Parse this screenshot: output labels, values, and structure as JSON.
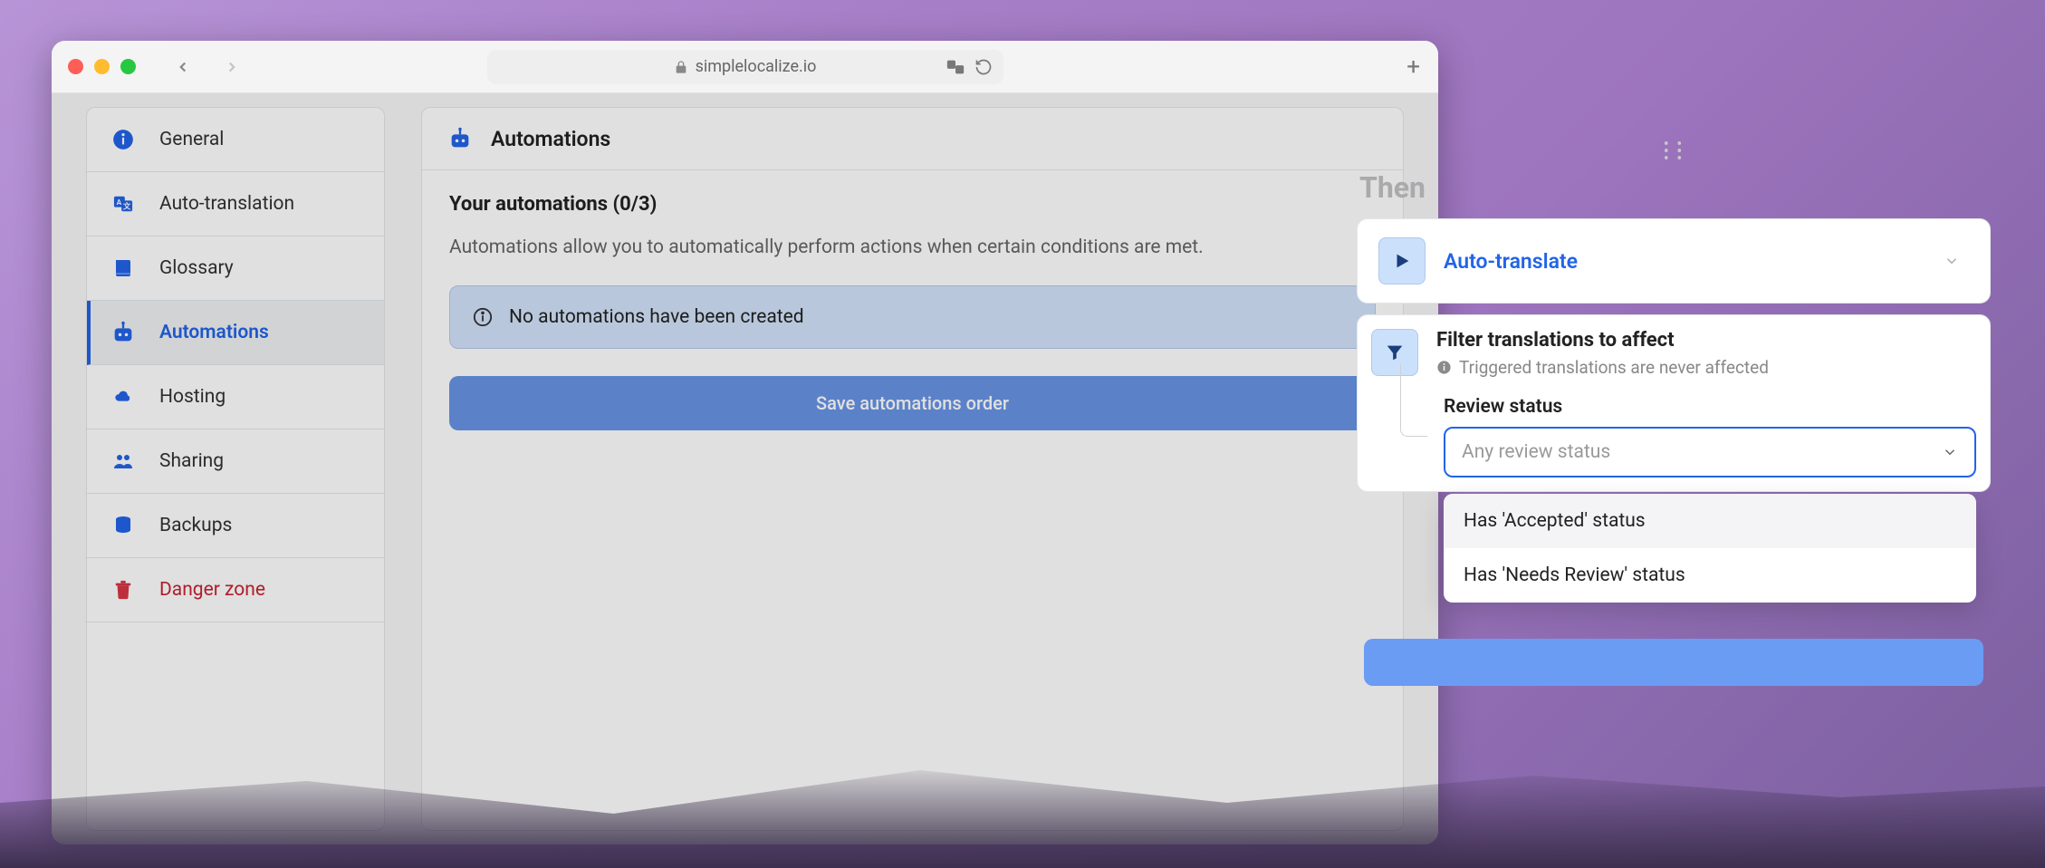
{
  "url": "simplelocalize.io",
  "sidebar": {
    "items": [
      {
        "label": "General"
      },
      {
        "label": "Auto-translation"
      },
      {
        "label": "Glossary"
      },
      {
        "label": "Automations"
      },
      {
        "label": "Hosting"
      },
      {
        "label": "Sharing"
      },
      {
        "label": "Backups"
      },
      {
        "label": "Danger zone"
      }
    ]
  },
  "main": {
    "header_title": "Automations",
    "subtitle": "Your automations (0/3)",
    "description": "Automations allow you to automatically perform actions when certain conditions are met.",
    "callout": "No automations have been created",
    "save_label": "Save automations order"
  },
  "sheet": {
    "then_label": "Then",
    "action_label": "Auto-translate",
    "filter_title": "Filter translations to affect",
    "filter_subtitle": "Triggered translations are never affected",
    "field_label": "Review status",
    "select_placeholder": "Any review status",
    "options": [
      "Has 'Accepted' status",
      "Has 'Needs Review' status"
    ]
  }
}
